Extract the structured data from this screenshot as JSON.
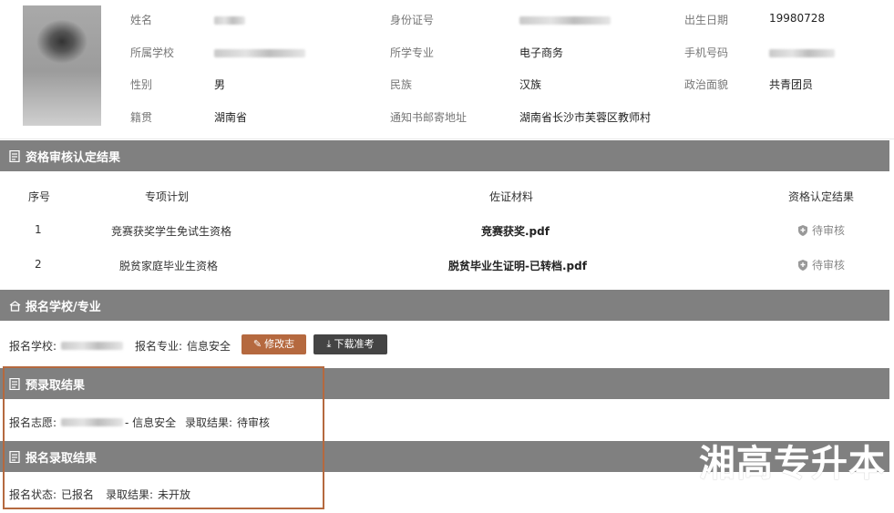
{
  "profile": {
    "name_label": "姓名",
    "id_label": "身份证号",
    "birth_label": "出生日期",
    "birth_value": "19980728",
    "school_label": "所属学校",
    "major_label": "所学专业",
    "major_value": "电子商务",
    "phone_label": "手机号码",
    "gender_label": "性别",
    "gender_value": "男",
    "ethnic_label": "民族",
    "ethnic_value": "汉族",
    "political_label": "政治面貌",
    "political_value": "共青团员",
    "native_label": "籍贯",
    "native_value": "湖南省",
    "address_label": "通知书邮寄地址",
    "address_value": "湖南省长沙市芙蓉区教师村"
  },
  "qual_section": {
    "title": "资格审核认定结果",
    "headers": [
      "序号",
      "专项计划",
      "佐证材料",
      "资格认定结果"
    ],
    "rows": [
      {
        "no": "1",
        "plan": "竞赛获奖学生免试生资格",
        "material": "竞赛获奖.pdf",
        "result": "待审核"
      },
      {
        "no": "2",
        "plan": "脱贫家庭毕业生资格",
        "material": "脱贫毕业生证明-已转档.pdf",
        "result": "待审核"
      }
    ]
  },
  "apply_section": {
    "title": "报名学校/专业",
    "school_label": "报名学校:",
    "major_label": "报名专业:",
    "major_value": "信息安全",
    "modify_button": "修改志愿",
    "download_button": "下载准考证",
    "modify_color": "#b5693f",
    "download_color": "#444444"
  },
  "pre_section": {
    "title": "预录取结果",
    "wish_label": "报名志愿:",
    "wish_major": "- 信息安全",
    "result_label": "录取结果:",
    "result_value": "待审核"
  },
  "enroll_section": {
    "title": "报名录取结果",
    "status_label": "报名状态:",
    "status_value": "已报名",
    "result_label": "录取结果:",
    "result_value": "未开放"
  },
  "watermark": "湘高专升本",
  "icons": {
    "section_doc": "document-icon",
    "section_school": "school-icon",
    "pending_shield": "shield-icon",
    "edit": "edit-icon",
    "download": "download-icon"
  }
}
